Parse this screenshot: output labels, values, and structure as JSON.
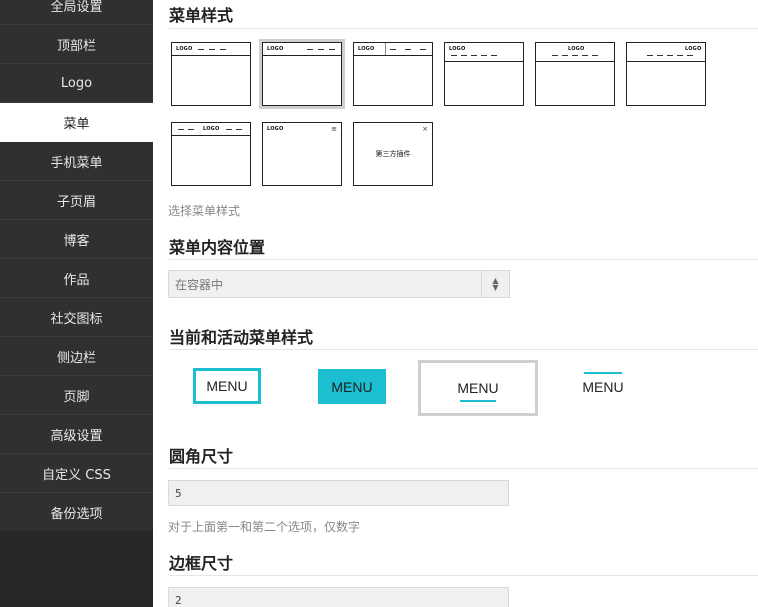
{
  "sidebar": {
    "items": [
      {
        "label": "全局设置",
        "active": false
      },
      {
        "label": "顶部栏",
        "active": false
      },
      {
        "label": "Logo",
        "active": false
      },
      {
        "label": "菜单",
        "active": true
      },
      {
        "label": "手机菜单",
        "active": false
      },
      {
        "label": "子页眉",
        "active": false
      },
      {
        "label": "博客",
        "active": false
      },
      {
        "label": "作品",
        "active": false
      },
      {
        "label": "社交图标",
        "active": false
      },
      {
        "label": "侧边栏",
        "active": false
      },
      {
        "label": "页脚",
        "active": false
      },
      {
        "label": "高级设置",
        "active": false
      },
      {
        "label": "自定义 CSS",
        "active": false
      },
      {
        "label": "备份选项",
        "active": false
      }
    ]
  },
  "menu_style": {
    "title": "菜单样式",
    "help": "选择菜单样式",
    "logo_text": "LOGO",
    "third_party_text": "第三方插件",
    "close_glyph": "×",
    "menu_glyph": "≡"
  },
  "menu_position": {
    "title": "菜单内容位置",
    "value": "在容器中"
  },
  "current_active": {
    "title": "当前和活动菜单样式",
    "options": [
      "MENU",
      "MENU",
      "MENU",
      "MENU"
    ]
  },
  "border_radius": {
    "title": "圆角尺寸",
    "value": "5",
    "help": "对于上面第一和第二个选项，仅数字"
  },
  "border_size": {
    "title": "边框尺寸",
    "value": "2"
  },
  "colors": {
    "accent": "#1cbfd0",
    "sidebar_bg": "#303030",
    "selected_outline": "#cfcfcf"
  }
}
